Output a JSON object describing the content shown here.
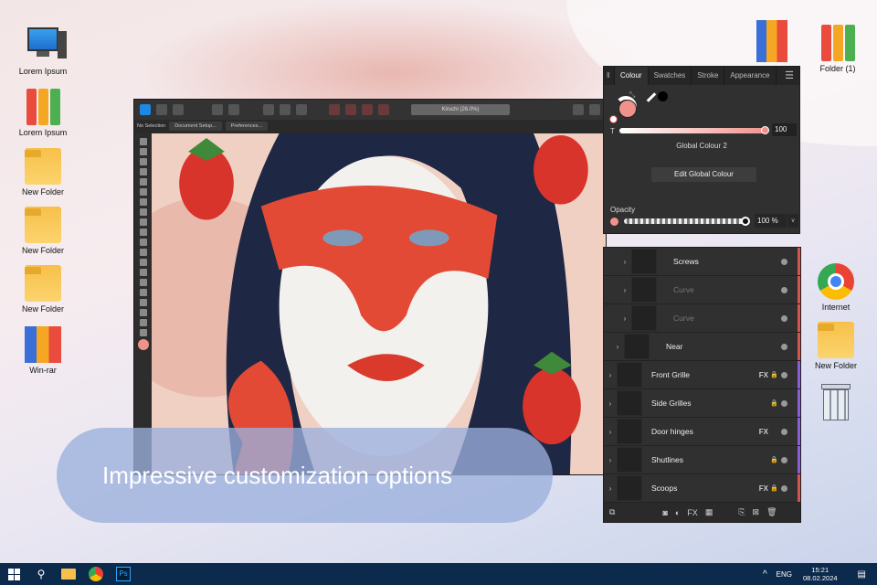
{
  "desktop_left": [
    {
      "label": "Lorem Ipsum",
      "icon": "computer-icon"
    },
    {
      "label": "Lorem Ipsum",
      "icon": "binders-icon"
    },
    {
      "label": "New Folder",
      "icon": "folder-icon"
    },
    {
      "label": "New Folder",
      "icon": "folder-icon"
    },
    {
      "label": "New Folder",
      "icon": "folder-icon"
    },
    {
      "label": "Win-rar",
      "icon": "winrar-icon"
    }
  ],
  "desktop_right": [
    {
      "label": "Folder (1)"
    },
    {
      "label": "Internet"
    },
    {
      "label": "New Folder"
    }
  ],
  "app": {
    "doc_title": "Kiruchi (26.0%)",
    "no_selection": "No Selection",
    "document_setup": "Document Setup...",
    "preferences": "Preferences..."
  },
  "colour_panel": {
    "tabs": [
      "Colour",
      "Swatches",
      "Stroke",
      "Appearance"
    ],
    "t_label": "T",
    "tint_value": "100",
    "global_colour": "Global Colour 2",
    "edit_button": "Edit Global Colour",
    "opacity_label": "Opacity",
    "opacity_value": "100 %",
    "accent": "#f0928c"
  },
  "layers": [
    {
      "name": "Screws",
      "dim": false,
      "fx": false,
      "lock": false,
      "color": "#d9534f",
      "indent": 2
    },
    {
      "name": "Curve",
      "dim": true,
      "fx": false,
      "lock": false,
      "color": "#d9534f",
      "indent": 2
    },
    {
      "name": "Curve",
      "dim": true,
      "fx": false,
      "lock": false,
      "color": "#d9534f",
      "indent": 2
    },
    {
      "name": "Near",
      "dim": false,
      "fx": false,
      "lock": false,
      "color": "#d9534f",
      "indent": 1
    },
    {
      "name": "Front Grille",
      "dim": false,
      "fx": true,
      "lock": true,
      "color": "#8a5fd6",
      "indent": 0
    },
    {
      "name": "Side Grilles",
      "dim": false,
      "fx": false,
      "lock": true,
      "color": "#8a5fd6",
      "indent": 0
    },
    {
      "name": "Door hinges",
      "dim": false,
      "fx": true,
      "lock": false,
      "color": "#8a5fd6",
      "indent": 0
    },
    {
      "name": "Shutlines",
      "dim": false,
      "fx": false,
      "lock": true,
      "color": "#8a5fd6",
      "indent": 0
    },
    {
      "name": "Scoops",
      "dim": false,
      "fx": true,
      "lock": true,
      "color": "#d9534f",
      "indent": 0
    }
  ],
  "fx_label": "FX",
  "caption": "Impressive customization options",
  "taskbar": {
    "lang": "ENG",
    "time": "15:21",
    "date": "08.02.2024"
  }
}
